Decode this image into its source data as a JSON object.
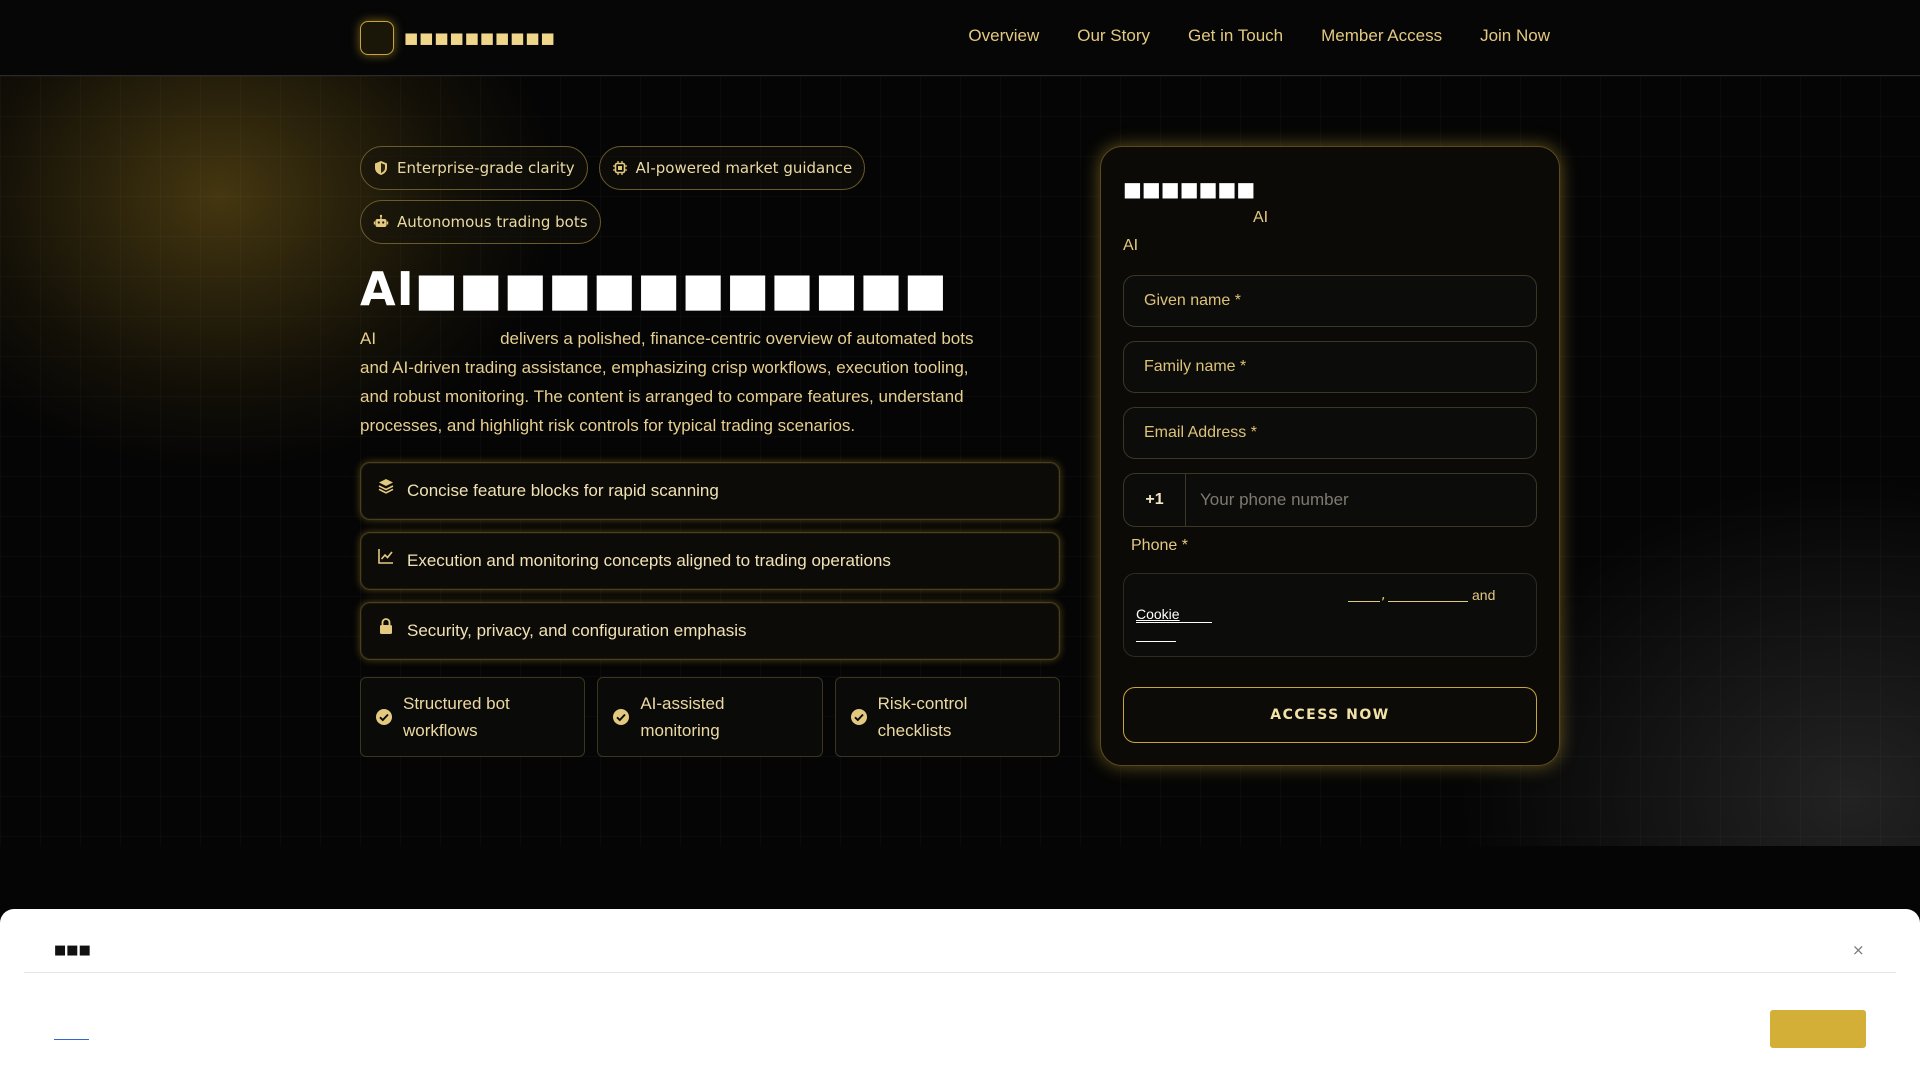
{
  "nav": {
    "brand_name": "■■■■■■■■■■",
    "links": [
      "Overview",
      "Our Story",
      "Get in Touch",
      "Member Access",
      "Join Now"
    ]
  },
  "hero": {
    "pills": [
      "Enterprise-grade clarity",
      "AI-powered market guidance",
      "Autonomous trading bots"
    ],
    "headline": "AI■■■■■■■■■■■■",
    "intro_prefix": "AI",
    "intro": "delivers a polished, finance-centric overview of automated bots and AI-driven trading assistance, emphasizing crisp workflows, execution tooling, and robust monitoring. The content is arranged to compare features, understand processes, and highlight risk controls for typical trading scenarios.",
    "features": [
      "Concise feature blocks for rapid scanning",
      "Execution and monitoring concepts aligned to trading operations",
      "Security, privacy, and configuration emphasis"
    ],
    "cards": [
      "Structured bot workflows",
      "AI-assisted monitoring",
      "Risk-control checklists"
    ]
  },
  "form": {
    "title": "■■■■■■■",
    "sub1": "AI",
    "sub2": "AI",
    "given_name_placeholder": "Given name *",
    "family_name_placeholder": "Family name *",
    "email_placeholder": "Email Address *",
    "phone_code": "+1",
    "phone_placeholder": "Your phone number",
    "phone_label": "Phone *",
    "consent_and": "and",
    "consent_comma": ",",
    "consent_cookie": "Cookie",
    "submit_label": "ACCESS NOW"
  },
  "cookie_banner": {
    "title": "■■■",
    "close": "×"
  },
  "colors": {
    "accent": "#d4af37",
    "background": "#050505",
    "text_gold": "#e3c980"
  }
}
